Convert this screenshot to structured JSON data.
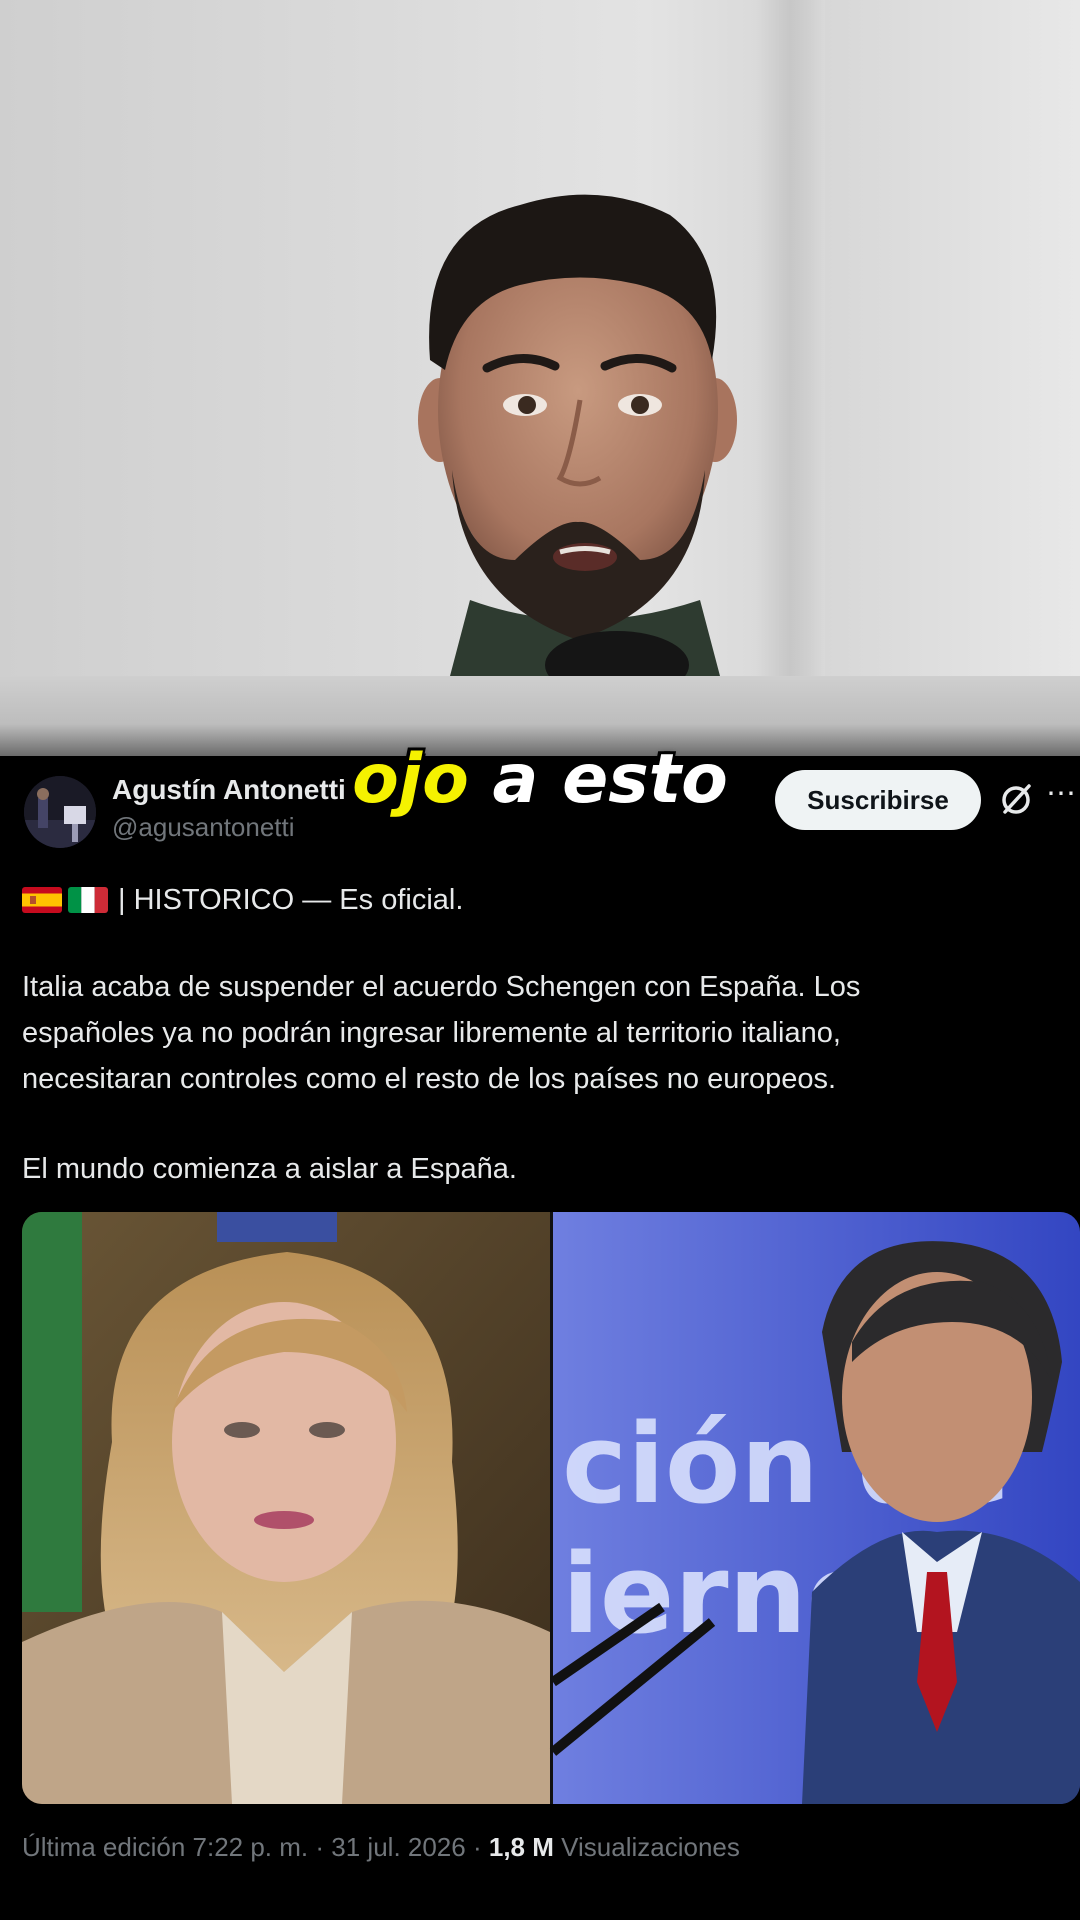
{
  "subtitle": {
    "word1": "ojo",
    "word2": "a esto"
  },
  "tweet": {
    "display_name": "Agustín Antonetti",
    "handle": "@agusantonetti",
    "subscribe_label": "Suscribirse",
    "header_line": "| HISTORICO — Es oficial.",
    "body_lines": [
      "Italia acaba de suspender el acuerdo Schengen con España. Los",
      "españoles ya no podrán ingresar libremente al territorio italiano,",
      "necesitaran controles como el resto de los países no europeos."
    ],
    "closing_line": "El mundo comienza a aislar a España.",
    "image_text": "ción de\niernc",
    "meta": {
      "edited": "Última edición 7:22 p. m.",
      "sep": "·",
      "date": "31 jul. 2026",
      "views_count": "1,8 M",
      "views_label": "Visualizaciones"
    }
  },
  "icons": {
    "flags": [
      "spain-flag-icon",
      "italy-flag-icon"
    ],
    "grok": "grok-icon",
    "more": "more-icon"
  },
  "colors": {
    "background": "#000000",
    "text": "#e7e9ea",
    "muted": "#71767b",
    "subtitle_highlight": "#f5f200",
    "subscribe_bg": "#eff3f4"
  }
}
